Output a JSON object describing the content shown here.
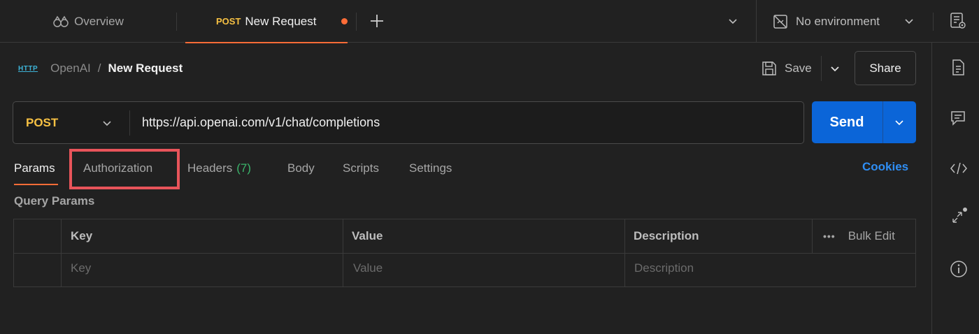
{
  "tabs": {
    "overview_label": "Overview",
    "active_method": "POST",
    "active_label": "New Request"
  },
  "environment": {
    "label": "No environment"
  },
  "breadcrumb": {
    "icon_text": "HTTP",
    "parent": "OpenAI",
    "separator": "/",
    "current": "New Request"
  },
  "actions": {
    "save_label": "Save",
    "share_label": "Share"
  },
  "request": {
    "method": "POST",
    "url": "https://api.openai.com/v1/chat/completions",
    "send_label": "Send"
  },
  "request_tabs": {
    "params": "Params",
    "authorization": "Authorization",
    "headers": "Headers",
    "headers_count": "(7)",
    "body": "Body",
    "scripts": "Scripts",
    "settings": "Settings",
    "cookies": "Cookies"
  },
  "query_params": {
    "title": "Query Params",
    "columns": [
      "Key",
      "Value",
      "Description"
    ],
    "bulk_edit": "Bulk Edit",
    "more": "•••",
    "placeholders": {
      "key": "Key",
      "value": "Value",
      "description": "Description"
    }
  },
  "colors": {
    "accent": "#ff6c37",
    "method": "#f7c143",
    "send": "#0b65d8",
    "cookies": "#2f8ef4",
    "highlight": "#e8545a"
  }
}
